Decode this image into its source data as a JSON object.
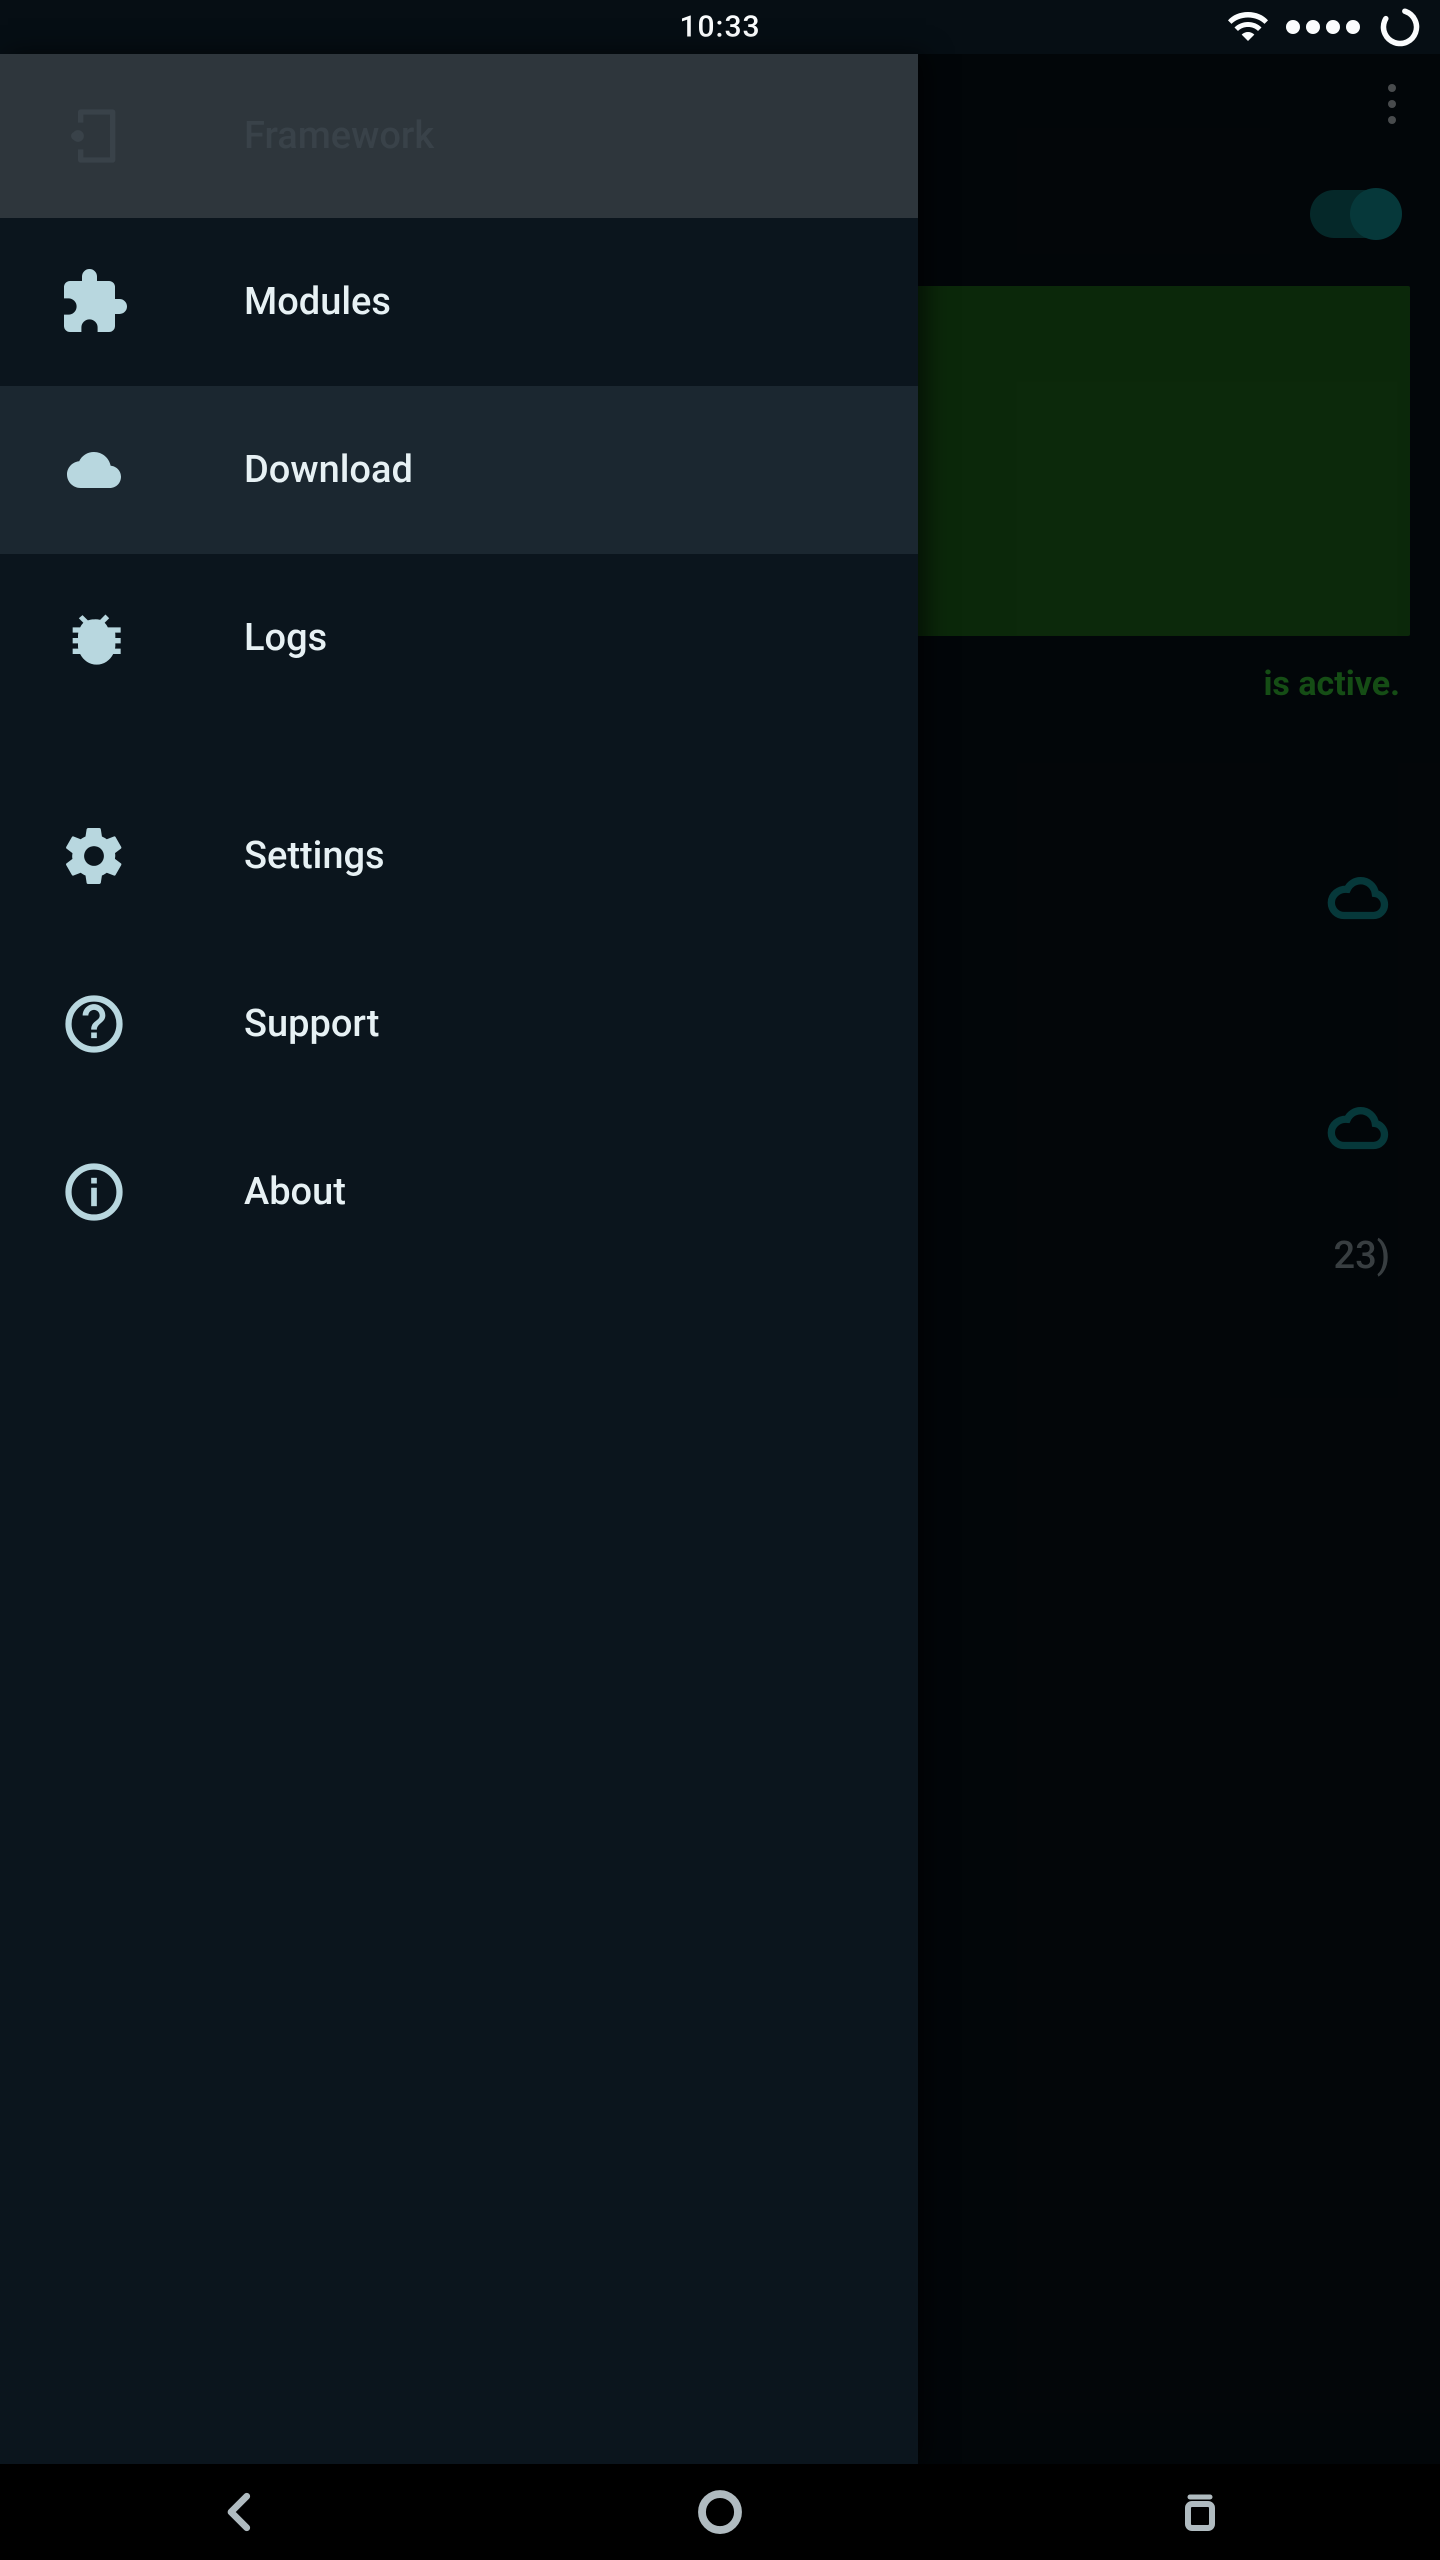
{
  "status_bar": {
    "time": "10:33"
  },
  "drawer": {
    "items": [
      {
        "label": "Framework",
        "icon": "framework-icon"
      },
      {
        "label": "Modules",
        "icon": "puzzle-icon"
      },
      {
        "label": "Download",
        "icon": "cloud-icon"
      },
      {
        "label": "Logs",
        "icon": "bug-icon"
      },
      {
        "label": "Settings",
        "icon": "gear-icon"
      },
      {
        "label": "Support",
        "icon": "help-icon"
      },
      {
        "label": "About",
        "icon": "info-icon"
      }
    ],
    "selected_index": 2
  },
  "main": {
    "status_suffix": "is active.",
    "sdk_suffix": "23)",
    "toggle_on": true
  },
  "colors": {
    "accent": "#0f7d80",
    "status_green": "#2faa2f",
    "card_green": "#1a5a18",
    "drawer_bg": "#0b151d",
    "drawer_selected": "#1b2730",
    "icon_tint": "#b8d7df"
  }
}
